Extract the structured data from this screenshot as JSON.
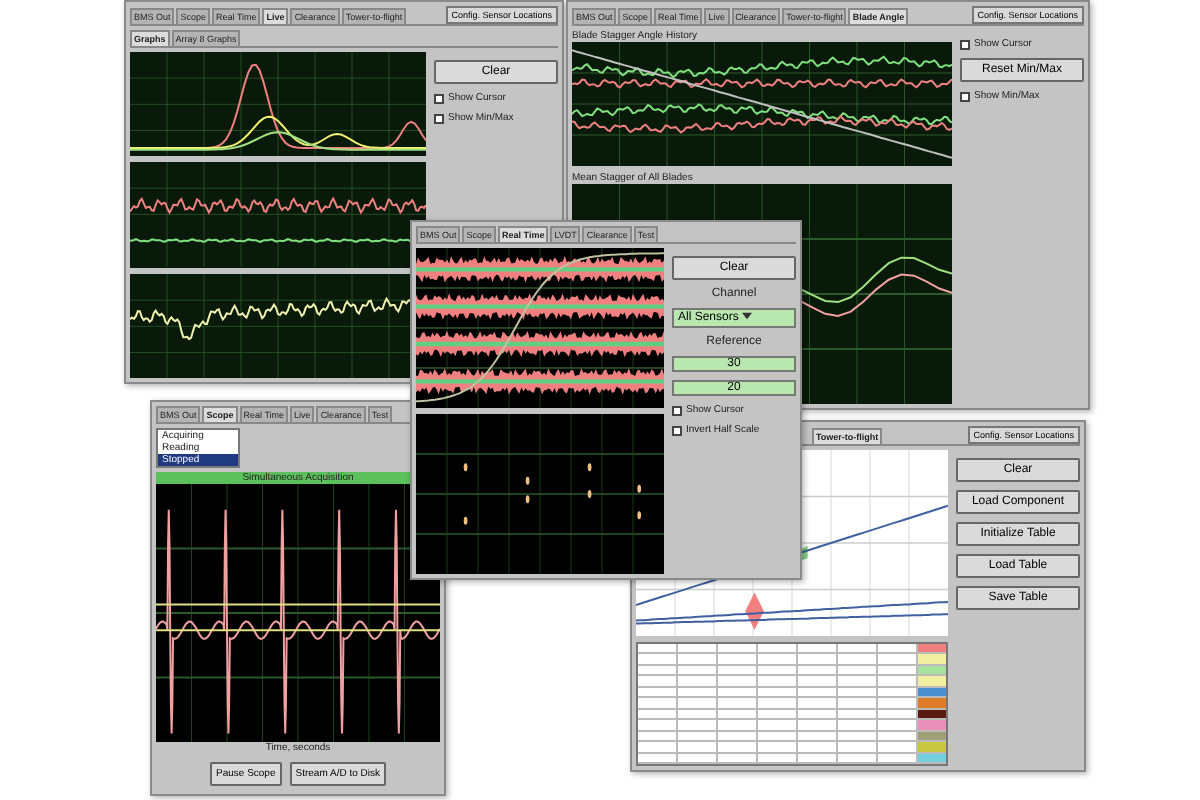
{
  "windows": [
    {
      "tabs": [
        {
          "label": "BMS Out",
          "selected": false
        },
        {
          "label": "Scope",
          "selected": false
        },
        {
          "label": "Real Time",
          "selected": false
        },
        {
          "label": "Live",
          "selected": true
        },
        {
          "label": "Clearance",
          "selected": false
        },
        {
          "label": "Tower-to-flight",
          "selected": false
        }
      ],
      "header_button": "Config. Sensor Locations",
      "subtabs": [
        {
          "label": "Graphs",
          "selected": true
        },
        {
          "label": "Array 8 Graphs",
          "selected": false
        }
      ],
      "plots": [
        {
          "kind": "peaks"
        },
        {
          "kind": "noise"
        },
        {
          "kind": "trend-noise"
        }
      ],
      "controls": [
        {
          "kind": "button",
          "label": "Clear"
        },
        {
          "kind": "checkbox",
          "label": "Show Cursor",
          "checked": false
        },
        {
          "kind": "checkbox",
          "label": "Show Min/Max",
          "checked": false
        }
      ]
    },
    {
      "tabs": [
        {
          "label": "BMS Out",
          "selected": false
        },
        {
          "label": "Scope",
          "selected": false
        },
        {
          "label": "Real Time",
          "selected": false
        },
        {
          "label": "Live",
          "selected": false
        },
        {
          "label": "Clearance",
          "selected": false
        },
        {
          "label": "Tower-to-flight",
          "selected": false
        },
        {
          "label": "Blade Angle",
          "selected": true
        }
      ],
      "header_button": "Config. Sensor Locations",
      "plots": [
        {
          "kind": "stagger",
          "title": "Blade Stagger Angle History"
        },
        {
          "kind": "mean",
          "title": "Mean Stagger of All Blades"
        }
      ],
      "controls": [
        {
          "kind": "checkbox",
          "label": "Show Cursor",
          "checked": false
        },
        {
          "kind": "button",
          "label": "Reset Min/Max"
        },
        {
          "kind": "checkbox",
          "label": "Show Min/Max",
          "checked": false
        }
      ]
    },
    {
      "tabs": [
        {
          "label": "BMS Out",
          "selected": false
        },
        {
          "label": "Scope",
          "selected": false
        },
        {
          "label": "Real Time",
          "selected": true
        },
        {
          "label": "LVDT",
          "selected": false
        },
        {
          "label": "Clearance",
          "selected": false
        },
        {
          "label": "Test",
          "selected": false
        }
      ],
      "plots": [
        {
          "kind": "bands"
        },
        {
          "kind": "dots"
        }
      ],
      "controls": [
        {
          "kind": "button",
          "label": "Clear"
        },
        {
          "kind": "label",
          "label": "Channel"
        },
        {
          "kind": "dropdown",
          "label": "All Sensors"
        },
        {
          "kind": "label",
          "label": "Reference"
        },
        {
          "kind": "field",
          "label": "30"
        },
        {
          "kind": "field",
          "label": "20"
        },
        {
          "kind": "checkbox",
          "label": "Show Cursor",
          "checked": false
        },
        {
          "kind": "checkbox",
          "label": "Invert Half Scale",
          "checked": false
        }
      ]
    },
    {
      "tabs": [
        {
          "label": "BMS Out",
          "selected": false
        },
        {
          "label": "Scope",
          "selected": true
        },
        {
          "label": "Real Time",
          "selected": false
        },
        {
          "label": "Live",
          "selected": false
        },
        {
          "label": "Clearance",
          "selected": false
        },
        {
          "label": "Test",
          "selected": false
        }
      ],
      "list": [
        {
          "label": "Acquiring",
          "selected": false
        },
        {
          "label": "Reading",
          "selected": false
        },
        {
          "label": "Stopped",
          "selected": true
        }
      ],
      "plots": [
        {
          "kind": "waveform",
          "title": "Simultaneous Acquisition",
          "xlabel": "Time, seconds"
        }
      ],
      "controls": [
        {
          "kind": "button",
          "label": "Pause Scope"
        },
        {
          "kind": "button",
          "label": "Stream A/D to Disk"
        }
      ]
    },
    {
      "tabs": [
        {
          "label": "Tower-to-flight",
          "selected": true
        }
      ],
      "header_button": "Config. Sensor Locations",
      "plots": [
        {
          "kind": "scatter"
        }
      ],
      "table_rows": [
        {
          "color": "#f08080"
        },
        {
          "color": "#f0f0a0"
        },
        {
          "color": "#a8e0a0"
        },
        {
          "color": "#f0f0a0"
        },
        {
          "color": "#4a90d0"
        },
        {
          "color": "#e07b2a"
        },
        {
          "color": "#5a1a10"
        },
        {
          "color": "#e890b8"
        },
        {
          "color": "#a0a078"
        },
        {
          "color": "#c8c840"
        },
        {
          "color": "#70d0e0"
        }
      ],
      "controls": [
        {
          "kind": "button",
          "label": "Clear"
        },
        {
          "kind": "button",
          "label": "Load Component"
        },
        {
          "kind": "button",
          "label": "Initialize Table"
        },
        {
          "kind": "button",
          "label": "Load Table"
        },
        {
          "kind": "button",
          "label": "Save Table"
        }
      ]
    }
  ]
}
